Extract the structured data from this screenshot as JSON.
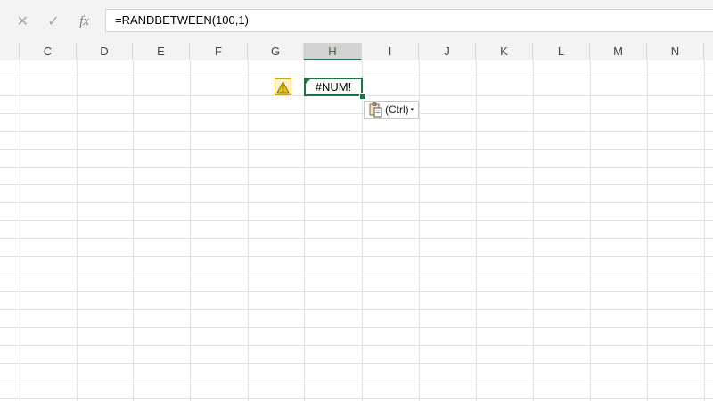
{
  "formula_bar": {
    "cancel_icon": "close-icon",
    "confirm_icon": "check-icon",
    "fx_label": "fx",
    "formula": "=RANDBETWEEN(100,1)"
  },
  "columns": [
    "C",
    "D",
    "E",
    "F",
    "G",
    "H",
    "I",
    "J",
    "K",
    "L",
    "M",
    "N"
  ],
  "active_column": "H",
  "active_cell": {
    "value": "#NUM!",
    "error_indicator_color": "#1e7a3a"
  },
  "error_button": {
    "icon": "warning-icon"
  },
  "paste_options": {
    "icon": "clipboard-icon",
    "label": "(Ctrl)",
    "caret": "▾"
  },
  "colors": {
    "accent": "#217346",
    "warning": "#c9a227"
  }
}
